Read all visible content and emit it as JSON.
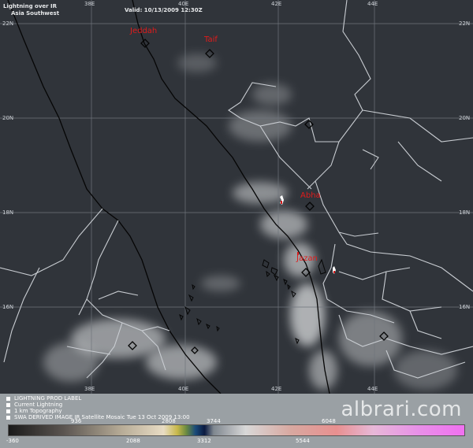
{
  "header": {
    "title_line1": "Lightning over IR",
    "title_line2": "Asia Southwest",
    "valid": "Valid: 10/13/2009 12:30Z"
  },
  "grid": {
    "lon_labels_top": [
      "38E",
      "40E",
      "42E",
      "44E"
    ],
    "lon_labels_bottom": [
      "38E",
      "40E",
      "42E",
      "44E"
    ],
    "lat_labels_left": [
      "22N",
      "20N",
      "18N",
      "16N"
    ],
    "lat_labels_right": [
      "22N",
      "20N",
      "18N",
      "16N"
    ]
  },
  "cities": [
    {
      "name": "Jeddah"
    },
    {
      "name": "Taif"
    },
    {
      "name": "Abha"
    },
    {
      "name": "Jazan"
    }
  ],
  "legend": {
    "items": [
      "LIGHTNING PROD LABEL",
      "Current Lightning",
      "1 km Topography"
    ],
    "product": "SWA DERIVED IMAGE IR  Satellite Mosaic  Tue 13 Oct 2009 13:00",
    "ticks_top": [
      "936",
      "2808",
      "3744",
      "6048"
    ],
    "ticks_bottom": [
      "-360",
      "2088",
      "3312",
      "5544"
    ]
  },
  "watermark": "albrari.com",
  "colors": {
    "background": "#30343a",
    "coast": "#000000",
    "border": "#c9cdd2",
    "city_label": "#e11b1b",
    "legend_bg": "#9aa0a4"
  }
}
